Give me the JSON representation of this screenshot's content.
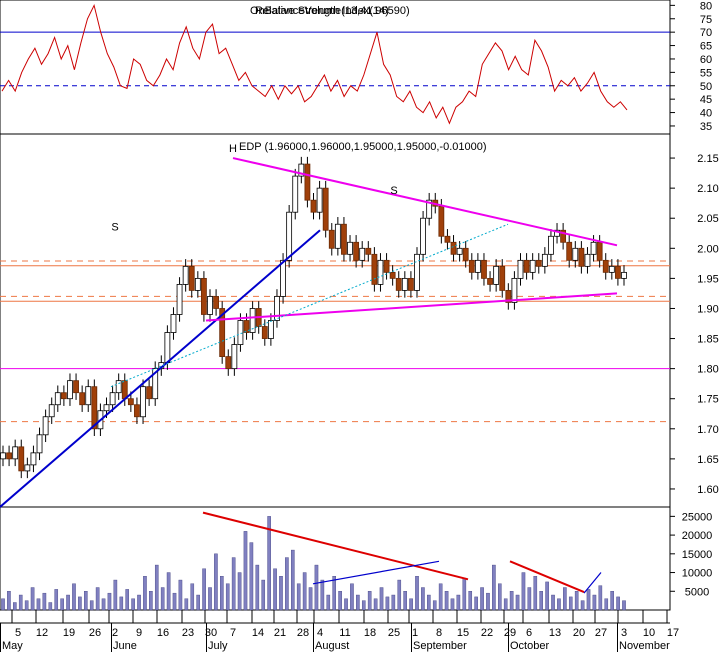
{
  "chart_data": [
    {
      "panel": "rsi",
      "type": "line",
      "title": "OnBalanceVolume(13,41.96590)",
      "title_overlay": "Relative Strength Index(14)",
      "yticks": [
        35,
        40,
        45,
        50,
        55,
        60,
        65,
        70,
        75,
        80
      ],
      "ylim": [
        32,
        82
      ],
      "reference_lines": [
        {
          "value": 70,
          "color": "#0000cc",
          "style": "solid"
        },
        {
          "value": 50,
          "color": "#0000cc",
          "style": "dashed"
        }
      ],
      "series": [
        {
          "color": "#cc0000",
          "values": [
            48,
            52,
            48,
            55,
            60,
            64,
            58,
            62,
            68,
            60,
            65,
            56,
            66,
            75,
            80,
            70,
            62,
            57,
            50,
            49,
            60,
            58,
            52,
            50,
            54,
            60,
            56,
            66,
            72,
            64,
            60,
            70,
            73,
            62,
            64,
            58,
            52,
            55,
            50,
            48,
            46,
            50,
            45,
            50,
            47,
            50,
            44,
            46,
            50,
            54,
            48,
            52,
            46,
            50,
            48,
            54,
            62,
            70,
            58,
            54,
            46,
            44,
            48,
            42,
            40,
            44,
            38,
            42,
            36,
            42,
            44,
            48,
            46,
            58,
            62,
            66,
            63,
            56,
            61,
            56,
            54,
            67,
            63,
            57,
            48,
            52,
            50,
            53,
            48,
            51,
            55,
            48,
            44,
            42,
            44,
            41
          ]
        }
      ]
    },
    {
      "panel": "price",
      "type": "candlestick",
      "title": "EDP (1.96000,1.96000,1.95000,1.95000,-0.01000)",
      "yticks": [
        1.6,
        1.65,
        1.7,
        1.75,
        1.8,
        1.85,
        1.9,
        1.95,
        2.0,
        2.05,
        2.1,
        2.15
      ],
      "ylim": [
        1.57,
        2.19
      ],
      "closes": [
        1.66,
        1.65,
        1.67,
        1.63,
        1.64,
        1.66,
        1.69,
        1.72,
        1.74,
        1.76,
        1.75,
        1.78,
        1.76,
        1.74,
        1.77,
        1.7,
        1.73,
        1.74,
        1.76,
        1.78,
        1.75,
        1.74,
        1.72,
        1.77,
        1.75,
        1.8,
        1.81,
        1.86,
        1.89,
        1.94,
        1.97,
        1.93,
        1.95,
        1.89,
        1.92,
        1.9,
        1.82,
        1.8,
        1.84,
        1.88,
        1.86,
        1.9,
        1.87,
        1.85,
        1.88,
        1.92,
        1.98,
        2.06,
        2.12,
        2.14,
        2.08,
        2.06,
        2.1,
        2.03,
        2.0,
        2.04,
        1.99,
        2.01,
        1.98,
        2.0,
        1.99,
        1.94,
        1.98,
        1.96,
        1.95,
        1.93,
        1.95,
        1.93,
        1.99,
        2.05,
        2.08,
        2.07,
        2.02,
        2.01,
        1.99,
        2.0,
        1.98,
        1.96,
        1.98,
        1.95,
        1.94,
        1.97,
        1.93,
        1.91,
        1.95,
        1.98,
        1.96,
        1.98,
        1.97,
        1.99,
        2.02,
        2.03,
        2.01,
        1.98,
        2.0,
        1.97,
        1.99,
        2.01,
        1.98,
        1.96,
        1.97,
        1.95,
        1.96
      ],
      "annotations": [
        {
          "text": "S",
          "x": "June 2",
          "y": 2.03
        },
        {
          "text": "H",
          "x": "July 7",
          "y": 2.16
        },
        {
          "text": "S",
          "x": "August 25",
          "y": 2.09
        }
      ],
      "lines": [
        {
          "role": "uptrend",
          "color": "#0000cc",
          "from": [
            "May 1",
            1.57
          ],
          "to": [
            "August 4",
            2.03
          ]
        },
        {
          "role": "triangle-top",
          "color": "#ee00ee",
          "from": [
            "July 7",
            2.15
          ],
          "to": [
            "November 7",
            2.005
          ]
        },
        {
          "role": "triangle-bottom",
          "color": "#ee00ee",
          "from": [
            "July 4",
            1.88
          ],
          "to": [
            "November 7",
            1.925
          ]
        },
        {
          "role": "dotted-trend",
          "color": "#00aacc",
          "from": [
            "June 5",
            1.77
          ],
          "to": [
            "October 9",
            2.04
          ]
        }
      ],
      "horizontal_lines": [
        {
          "value": 1.8,
          "color": "#ee00ee",
          "style": "solid"
        },
        {
          "value": 1.712,
          "color": "#ee7744",
          "style": "dashed"
        },
        {
          "value": 1.971,
          "color": "#ee7744",
          "style": "solid"
        },
        {
          "value": 1.979,
          "color": "#ee7744",
          "style": "dashed"
        },
        {
          "value": 1.912,
          "color": "#ee7744",
          "style": "solid"
        },
        {
          "value": 1.92,
          "color": "#ee7744",
          "style": "dashed"
        }
      ]
    },
    {
      "panel": "volume",
      "type": "bar",
      "yticks": [
        5000,
        10000,
        15000,
        20000,
        25000
      ],
      "ylim": [
        0,
        27500
      ],
      "values": [
        3000,
        5000,
        2000,
        4000,
        2500,
        6000,
        3000,
        4500,
        2000,
        5500,
        3000,
        4000,
        7000,
        3500,
        5000,
        2500,
        6000,
        3000,
        4500,
        8000,
        3500,
        5500,
        3000,
        4000,
        9000,
        5000,
        12000,
        6000,
        10000,
        4500,
        8000,
        3000,
        7000,
        4000,
        11000,
        6000,
        15000,
        9000,
        7000,
        14000,
        10000,
        21000,
        18000,
        12000,
        8000,
        25000,
        11000,
        9000,
        14000,
        16000,
        7000,
        10000,
        6000,
        12000,
        8000,
        4000,
        9000,
        5000,
        3000,
        7000,
        4000,
        2500,
        5000,
        3000,
        6000,
        3500,
        4000,
        8000,
        5000,
        3000,
        9000,
        6000,
        4000,
        2500,
        7000,
        5000,
        3000,
        4000,
        8500,
        5000,
        3500,
        6000,
        4500,
        12000,
        7000,
        3000,
        5000,
        4000,
        10000,
        6000,
        9000,
        5000,
        7500,
        4000,
        3000,
        6000,
        3500,
        5000,
        2500,
        5500,
        4000,
        6500,
        3000,
        5000,
        3500,
        2500
      ],
      "trend_lines": [
        {
          "color": "#dd0000",
          "from": [
            "June 30 -8",
            26000
          ],
          "to": [
            "September 15 +5",
            8200
          ]
        },
        {
          "color": "#0000cc",
          "from": [
            "August 15",
            7000
          ],
          "to": [
            "September 8",
            13000
          ]
        },
        {
          "color": "#dd0000",
          "from": [
            "September 29",
            13000
          ],
          "to": [
            "October 20 +5",
            4800
          ]
        },
        {
          "color": "#0000cc",
          "from": [
            "October 20 +5",
            4500
          ],
          "to": [
            "October 27",
            10000
          ]
        }
      ]
    }
  ],
  "x_axis": {
    "day_labels": [
      "5",
      "12",
      "19",
      "26",
      "2",
      "9",
      "16",
      "23",
      "30",
      "7",
      "14",
      "21",
      "28",
      "4",
      "11",
      "18",
      "25",
      "1",
      "8",
      "15",
      "22",
      "29",
      "6",
      "13",
      "20",
      "27",
      "3",
      "10",
      "17"
    ],
    "month_labels": [
      "May",
      "June",
      "July",
      "August",
      "September",
      "October",
      "November"
    ]
  }
}
